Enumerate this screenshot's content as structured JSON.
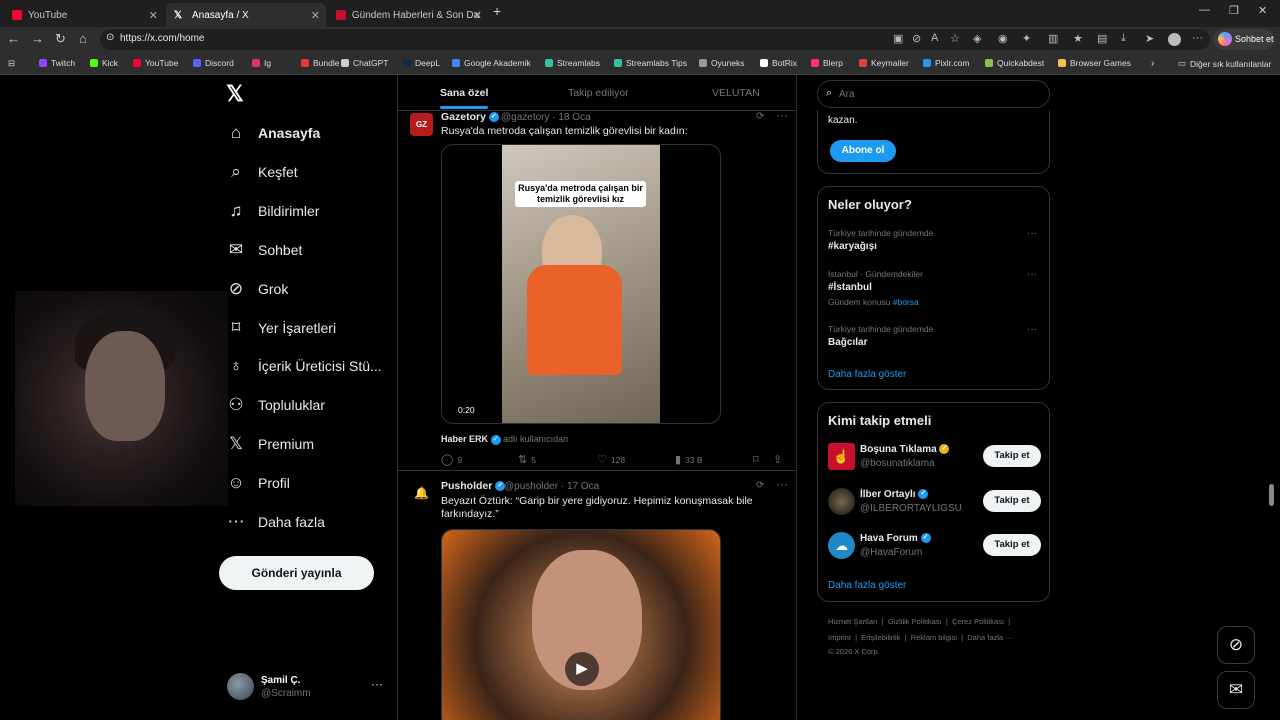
{
  "browser": {
    "tabs": [
      {
        "title": "YouTube",
        "color": "#ff0033"
      },
      {
        "title": "Anasayfa / X",
        "color": "#ffffff"
      },
      {
        "title": "Gündem Haberleri & Son Dakika H",
        "color": "#c8102e"
      }
    ],
    "url": "https://x.com/home",
    "copilot_label": "Sohbet et",
    "bookmarks": [
      {
        "label": "Twitch",
        "color": "#9146ff"
      },
      {
        "label": "Kick",
        "color": "#53fc18"
      },
      {
        "label": "YouTube",
        "color": "#ff0033"
      },
      {
        "label": "Discord",
        "color": "#5865f2"
      },
      {
        "label": "Ig",
        "color": "#e1306c"
      },
      {
        "label": "Bundle",
        "color": "#e53935"
      },
      {
        "label": "ChatGPT",
        "color": "#cccccc"
      },
      {
        "label": "DeepL",
        "color": "#0f2b46"
      },
      {
        "label": "Google Akademik",
        "color": "#4285f4"
      },
      {
        "label": "Streamlabs",
        "color": "#31c3a2"
      },
      {
        "label": "Streamlabs Tips",
        "color": "#31c3a2"
      },
      {
        "label": "Oyuneks",
        "color": "#999999"
      },
      {
        "label": "BotRix",
        "color": "#ffffff"
      },
      {
        "label": "Blerp",
        "color": "#ff3366"
      },
      {
        "label": "Keymailer",
        "color": "#e04040"
      },
      {
        "label": "Pixlr.com",
        "color": "#2196f3"
      },
      {
        "label": "Quickabdest",
        "color": "#8bc34a"
      },
      {
        "label": "Browser Games",
        "color": "#f2c14e"
      }
    ],
    "other_bookmarks": "Diğer sık kullanılanlar"
  },
  "sidebar": {
    "items": [
      {
        "label": "Anasayfa",
        "icon": "home-icon"
      },
      {
        "label": "Keşfet",
        "icon": "search-icon"
      },
      {
        "label": "Bildirimler",
        "icon": "bell-icon"
      },
      {
        "label": "Sohbet",
        "icon": "mail-icon"
      },
      {
        "label": "Grok",
        "icon": "grok-icon"
      },
      {
        "label": "Yer İşaretleri",
        "icon": "bookmark-icon"
      },
      {
        "label": "İçerik Üreticisi Stü...",
        "icon": "creator-icon"
      },
      {
        "label": "Topluluklar",
        "icon": "communities-icon"
      },
      {
        "label": "Premium",
        "icon": "x-icon"
      },
      {
        "label": "Profil",
        "icon": "profile-icon"
      },
      {
        "label": "Daha fazla",
        "icon": "more-icon"
      }
    ],
    "post_button": "Gönderi yayınla",
    "user": {
      "name": "Şamil Ç.",
      "handle": "@Scraimm"
    }
  },
  "feed": {
    "tabs": [
      "Sana özel",
      "Takip ediliyor",
      "VELUTAN"
    ],
    "posts": [
      {
        "name": "Gazetory",
        "handle": "@gazetory",
        "date": "18 Oca",
        "text": "Rusya'da metroda çalışan temizlik görevlisi bir kadın:",
        "video_caption": "Rusya'da metroda çalışan bir temizlik görevlisi kız",
        "duration": "0:20",
        "credit_name": "Haber ERK",
        "credit_note": "adlı kullanıcıdan",
        "replies": "9",
        "reposts": "5",
        "likes": "128",
        "views": "33 B"
      },
      {
        "name": "Pusholder",
        "handle": "@pusholder",
        "date": "17 Oca",
        "text": "Beyazıt Öztürk: “Garip bir yere gidiyoruz. Hepimiz konuşmasak bile farkındayız.”"
      }
    ]
  },
  "right": {
    "search_placeholder": "Ara",
    "premium_tail": "kazan.",
    "subscribe": "Abone ol",
    "trends_title": "Neler oluyor?",
    "trends": [
      {
        "meta": "Türkiye tarihinde gündemde",
        "name": "#karyağışı",
        "sub": ""
      },
      {
        "meta": "İstanbul · Gündemdekiler",
        "name": "#İstanbul",
        "sub": "Gündem konusu",
        "tag": "#borsa"
      },
      {
        "meta": "Türkiye tarihinde gündemde",
        "name": "Bağcılar",
        "sub": ""
      }
    ],
    "trends_more": "Daha fazla göster",
    "who_title": "Kimi takip etmeli",
    "who": [
      {
        "name": "Boşuna Tıklama",
        "handle": "@bosunatiklama",
        "color": "#c8102e"
      },
      {
        "name": "İlber Ortaylı",
        "handle": "@ILBERORTAYLIGSU",
        "color": "#2a2a2a"
      },
      {
        "name": "Hava Forum",
        "handle": "@HavaForum",
        "color": "#1e88c8"
      }
    ],
    "follow_label": "Takip et",
    "who_more": "Daha fazla göster",
    "footer": [
      "Hizmet Şartları",
      "Gizlilik Politikası",
      "Çerez Politikası",
      "Imprint",
      "Erişilebilirlik",
      "Reklam bilgisi",
      "Daha fazla ···",
      "© 2026 X Corp."
    ]
  }
}
